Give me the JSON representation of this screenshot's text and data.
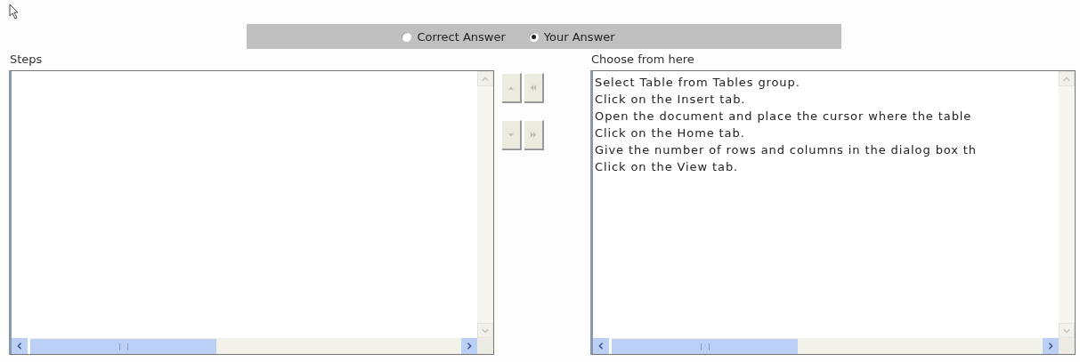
{
  "answer_mode": [
    {
      "label": "Correct Answer",
      "selected": false
    },
    {
      "label": "Your Answer",
      "selected": true
    }
  ],
  "steps": {
    "label": "Steps"
  },
  "move_buttons": [
    {
      "kind": "up",
      "disabled": true
    },
    {
      "kind": "remove",
      "disabled": true
    },
    {
      "kind": "down",
      "disabled": true
    },
    {
      "kind": "add",
      "disabled": true
    }
  ],
  "choices": {
    "label": "Choose from here",
    "items": [
      {
        "text": "Select Table from Tables group.",
        "selected": false
      },
      {
        "text": "Click on the Insert tab.",
        "selected": false
      },
      {
        "text": "Open the document and place the cursor where the table",
        "selected": false
      },
      {
        "text": "Click on the Home tab.",
        "selected": false
      },
      {
        "text": "Give the number of rows and columns in the dialog box th",
        "selected": false
      },
      {
        "text": "Click on the View tab.",
        "selected": false
      }
    ]
  }
}
